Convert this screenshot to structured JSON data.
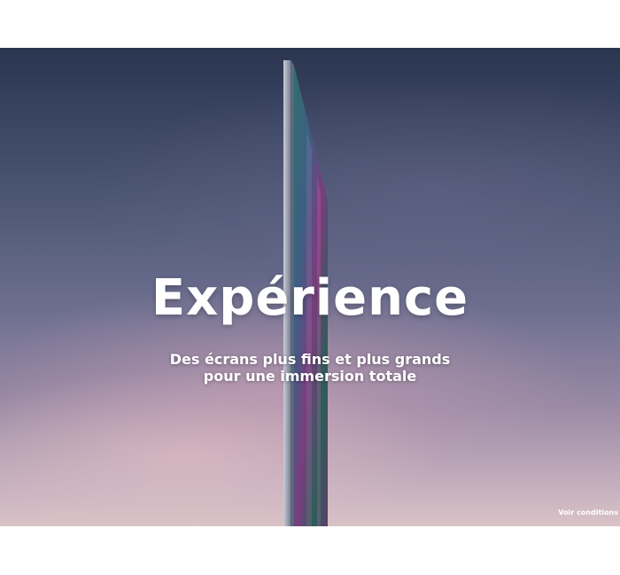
{
  "hero": {
    "headline": "Expérience",
    "subtitle_line1": "Des écrans plus fins et plus grands",
    "subtitle_line2": "pour une immersion totale",
    "conditions_link": "Voir conditions"
  },
  "colors": {
    "sky_top": "#2a3550",
    "sky_bottom": "#d9c3c6",
    "text": "#ffffff"
  }
}
